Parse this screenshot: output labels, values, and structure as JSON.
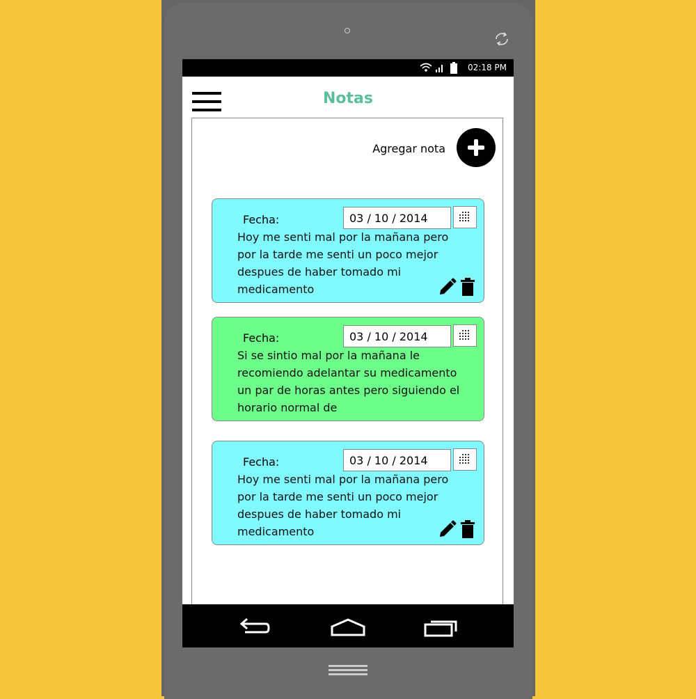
{
  "status_bar": {
    "time": "02:18 PM"
  },
  "header": {
    "title": "Notas"
  },
  "actions": {
    "add_note_label": "Agregar nota"
  },
  "notes": [
    {
      "date_label": "Fecha:",
      "date": "03 / 10 / 2014",
      "text": "Hoy me senti mal por la mañana pero por la tarde me senti un poco mejor despues de haber tomado mi medicamento",
      "color": "#80FAFF",
      "has_actions": true
    },
    {
      "date_label": "Fecha:",
      "date": "03 / 10 / 2014",
      "text": "Si se sintio mal por la mañana le recomiendo adelantar su medicamento un par de horas antes pero siguiendo el horario normal de",
      "color": "#6EFF8A",
      "has_actions": false
    },
    {
      "date_label": "Fecha:",
      "date": "03 / 10 / 2014",
      "text": "Hoy me senti mal por la mañana pero por la tarde me senti un poco mejor despues de haber tomado mi medicamento",
      "color": "#80FAFF",
      "has_actions": true
    }
  ],
  "icons": {
    "menu": "hamburger-menu-icon",
    "add": "plus-icon",
    "calendar": "calendar-icon",
    "edit": "pencil-icon",
    "delete": "trash-icon",
    "back": "back-icon",
    "home": "home-icon",
    "recents": "recents-icon"
  },
  "colors": {
    "title": "#5BBF9B",
    "background": "#F5C53B"
  }
}
